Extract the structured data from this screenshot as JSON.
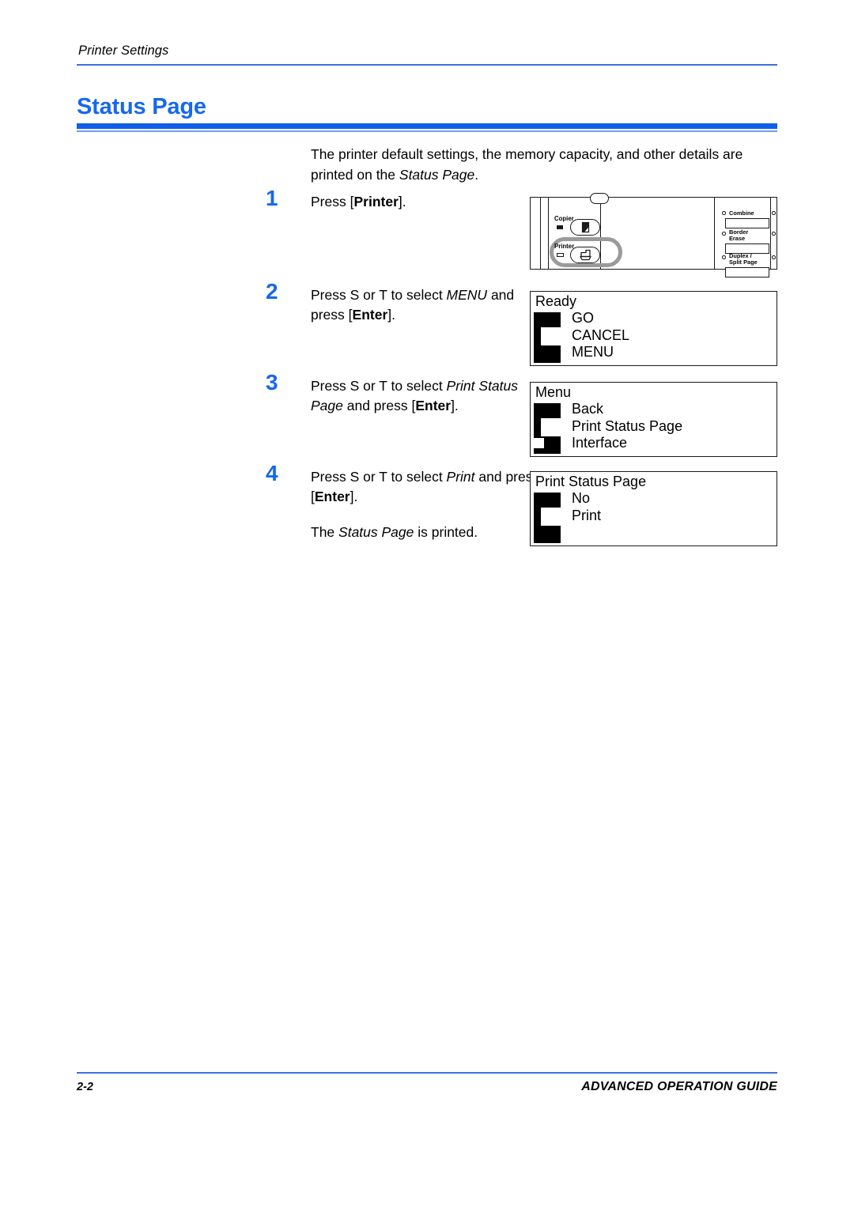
{
  "header": {
    "running_title": "Printer Settings"
  },
  "section": {
    "title": "Status Page"
  },
  "intro": {
    "line1": "The printer default settings, the memory capacity, and other details are",
    "line2_prefix": "printed on the ",
    "line2_italic": "Status Page",
    "line2_suffix": "."
  },
  "steps": [
    {
      "number": "1",
      "text_parts": {
        "p1": "Press [",
        "bold1": "Printer",
        "p2": "]."
      },
      "plain": "Press [Printer]."
    },
    {
      "number": "2",
      "text_parts": {
        "p1": "Press ",
        "arrow_up": "S",
        "p2": " or ",
        "arrow_down": "T",
        "p3": " to select ",
        "italic1": "MENU",
        "p4": " and press [",
        "bold1": "Enter",
        "p5": "]."
      },
      "plain": "Press S or T to select MENU and press [Enter]."
    },
    {
      "number": "3",
      "text_parts": {
        "p1": "Press ",
        "arrow_up": "S",
        "p2": " or ",
        "arrow_down": "T",
        "p3": " to select ",
        "italic1": "Print Status Page",
        "p4": " and press [",
        "bold1": "Enter",
        "p5": "]."
      },
      "plain": "Press S or T to select Print Status Page and press [Enter]."
    },
    {
      "number": "4",
      "text_parts": {
        "p1": "Press ",
        "arrow_up": "S",
        "p2": " or ",
        "arrow_down": "T",
        "p3": " to select ",
        "italic1": "Print",
        "p4": " and press [",
        "bold1": "Enter",
        "p5": "]."
      },
      "plain": "Press S or T to select Print and press [Enter].",
      "note": {
        "p1": "The ",
        "italic1": "Status Page",
        "p2": " is printed."
      }
    }
  ],
  "control_panel": {
    "copier_label": "Copier",
    "printer_label": "Printer",
    "copier_icon": "document-page-icon",
    "printer_icon": "printer-icon",
    "copier_led": "led-filled",
    "printer_led": "led-hollow",
    "highlight": "printer-button-highlight",
    "right_buttons": [
      {
        "label": "Combine",
        "label2": ""
      },
      {
        "label": "Border",
        "label2": "Erase"
      },
      {
        "label": "Duplex /",
        "label2": "Split Page"
      }
    ]
  },
  "lcd_screens": [
    {
      "name": "ready-screen",
      "title": "Ready",
      "items": [
        "GO",
        "CANCEL",
        "MENU"
      ],
      "cursor_index": 2,
      "cursor_size": "big"
    },
    {
      "name": "menu-screen",
      "title": "Menu",
      "items": [
        "Back",
        "Print Status Page",
        "Interface"
      ],
      "cursor_index": 1,
      "cursor_size": "big",
      "second_cursor_index": 2,
      "second_cursor_size": "small"
    },
    {
      "name": "print-status-page-screen",
      "title": "Print Status Page",
      "items": [
        "No",
        "Print"
      ],
      "cursor_index": 1,
      "cursor_size": "big"
    }
  ],
  "footer": {
    "page_number": "2-2",
    "guide_title": "ADVANCED OPERATION GUIDE"
  },
  "colors": {
    "heading_blue": "#1668ec",
    "rule_blue": "#0f5fe8",
    "thin_rule_blue": "#3f6fe0",
    "step_number_blue": "#1668ec"
  }
}
